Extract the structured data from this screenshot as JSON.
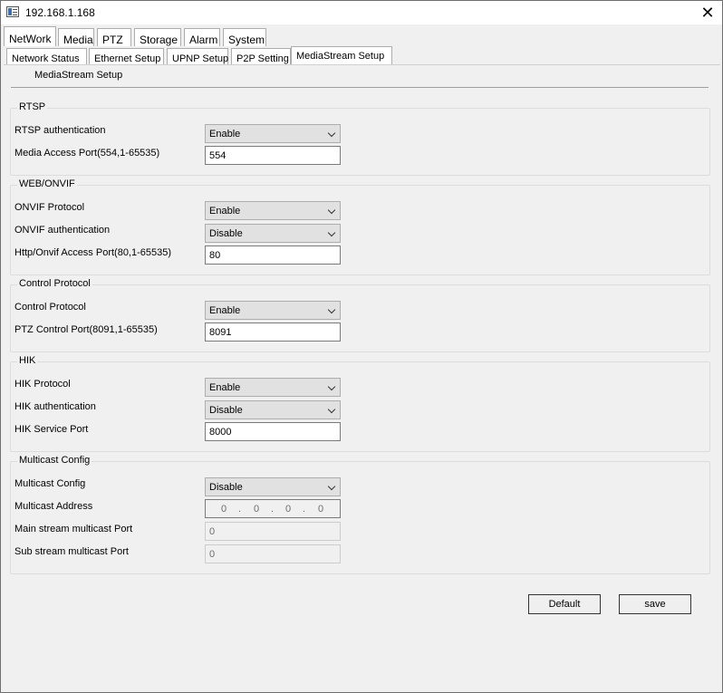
{
  "window": {
    "title": "192.168.1.168"
  },
  "main_tabs": [
    {
      "label": "NetWork"
    },
    {
      "label": "Media"
    },
    {
      "label": "PTZ"
    },
    {
      "label": "Storage"
    },
    {
      "label": "Alarm"
    },
    {
      "label": "System"
    }
  ],
  "sub_tabs": [
    {
      "label": "Network Status"
    },
    {
      "label": "Ethernet Setup"
    },
    {
      "label": "UPNP Setup"
    },
    {
      "label": "P2P Setting"
    },
    {
      "label": "MediaStream Setup"
    }
  ],
  "page_title": "MediaStream Setup",
  "rtsp": {
    "title": "RTSP",
    "auth_label": "RTSP authentication",
    "auth_value": "Enable",
    "port_label": "Media Access Port(554,1-65535)",
    "port_value": "554"
  },
  "web_onvif": {
    "title": "WEB/ONVIF",
    "protocol_label": "ONVIF Protocol",
    "protocol_value": "Enable",
    "auth_label": "ONVIF authentication",
    "auth_value": "Disable",
    "port_label": "Http/Onvif Access Port(80,1-65535)",
    "port_value": "80"
  },
  "control": {
    "title": "Control Protocol",
    "protocol_label": "Control Protocol",
    "protocol_value": "Enable",
    "port_label": "PTZ Control Port(8091,1-65535)",
    "port_value": "8091"
  },
  "hik": {
    "title": "HIK",
    "protocol_label": "HIK Protocol",
    "protocol_value": "Enable",
    "auth_label": "HIK authentication",
    "auth_value": "Disable",
    "port_label": "HIK Service Port",
    "port_value": "8000"
  },
  "multicast": {
    "title": "Multicast Config",
    "config_label": "Multicast Config",
    "config_value": "Disable",
    "address_label": "Multicast Address",
    "address_octets": [
      "0",
      "0",
      "0",
      "0"
    ],
    "dot": ".",
    "main_port_label": "Main stream multicast Port",
    "main_port_value": "0",
    "sub_port_label": "Sub stream multicast Port",
    "sub_port_value": "0"
  },
  "buttons": {
    "default_label": "Default",
    "save_label": "save"
  },
  "icons": {
    "close": "close-icon",
    "app": "app-icon",
    "dropdown": "chevron-down-icon"
  }
}
